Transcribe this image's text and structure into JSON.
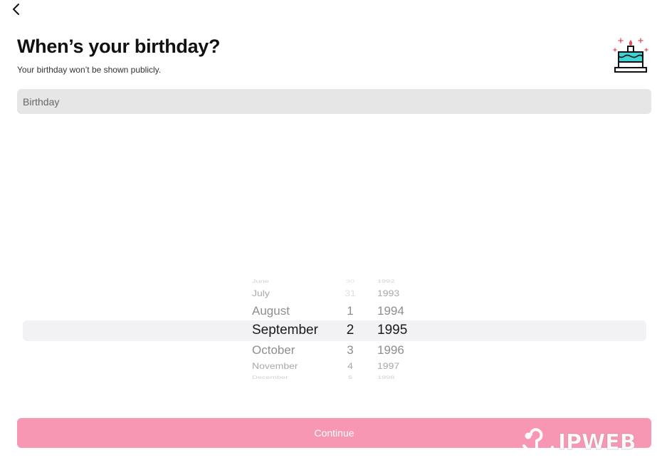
{
  "header": {
    "back_icon": "chevron-left-icon",
    "title": "When’s your birthday?",
    "subtitle": "Your birthday won’t be shown publicly.",
    "illustration_icon": "birthday-cake-icon"
  },
  "birthday_field": {
    "placeholder": "Birthday",
    "value": ""
  },
  "picker": {
    "months": [
      "June",
      "July",
      "August",
      "September",
      "October",
      "November",
      "December"
    ],
    "days": [
      "30",
      "31",
      "1",
      "2",
      "3",
      "4",
      "5"
    ],
    "years": [
      "1992",
      "1993",
      "1994",
      "1995",
      "1996",
      "1997",
      "1998"
    ],
    "selected": {
      "month": "September",
      "day": "2",
      "year": "1995"
    }
  },
  "continue_button": {
    "label": "Continue",
    "enabled": false,
    "color": "#f797b3"
  },
  "watermark": {
    "text": "IPWEB"
  },
  "colors": {
    "accent_pink": "#f797b3",
    "field_bg": "#e6e6e6",
    "picker_highlight": "#f2f2f4",
    "cake_teal": "#3fd4d4",
    "cake_red": "#e84a5f"
  }
}
